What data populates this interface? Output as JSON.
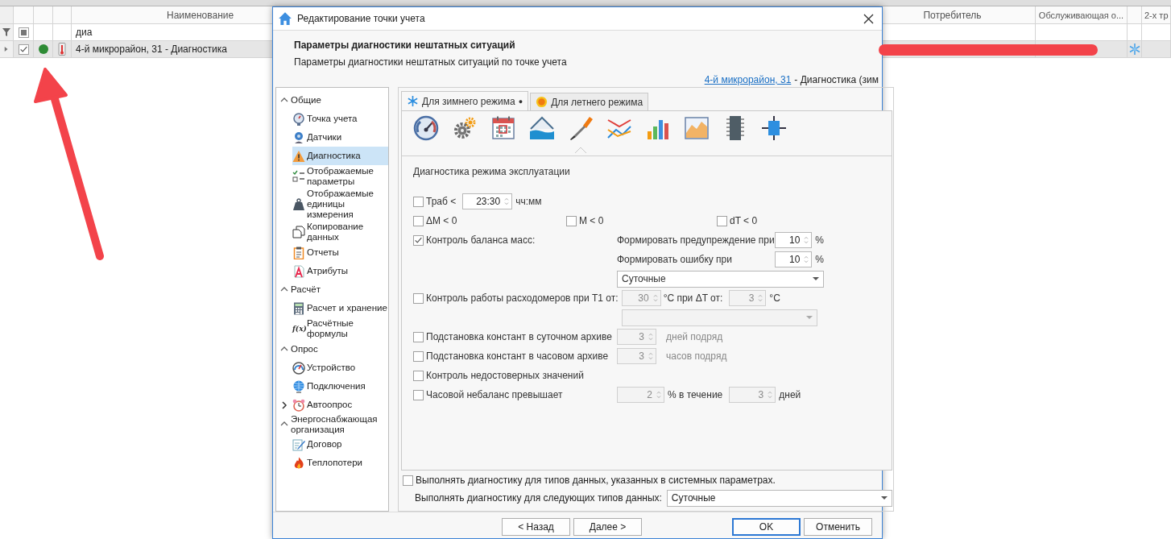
{
  "background_grid": {
    "columns": [
      {
        "label": "Наименование"
      },
      {
        "label": "Потребитель"
      },
      {
        "label": "Обслуживающая о..."
      },
      {
        "label": "2-х тр"
      }
    ],
    "filter": {
      "value": "диа",
      "indeterminate": true
    },
    "rows": [
      {
        "name": "4-й микрорайон, 31 - Диагностика",
        "checked": true,
        "selected": true
      }
    ]
  },
  "dialog": {
    "title": "Редактирование точки учета",
    "header": {
      "title": "Параметры диагностики нештатных ситуаций",
      "subtitle": "Параметры диагностики нештатных ситуаций по точке учета",
      "link": "4-й микрорайон, 31",
      "link_suffix": "- Диагностика (зим"
    },
    "nav": {
      "sections": [
        {
          "label": "Общие",
          "expanded": true,
          "items": [
            {
              "label": "Точка учета",
              "selected": false,
              "expandable": false
            },
            {
              "label": "Датчики",
              "selected": false,
              "expandable": false
            },
            {
              "label": "Диагностика",
              "selected": true,
              "expandable": false
            },
            {
              "label": "Отображаемые параметры",
              "selected": false,
              "expandable": false
            },
            {
              "label": "Отображаемые единицы измерения",
              "selected": false,
              "expandable": false
            },
            {
              "label": "Копирование данных",
              "selected": false,
              "expandable": false
            },
            {
              "label": "Отчеты",
              "selected": false,
              "expandable": false
            },
            {
              "label": "Атрибуты",
              "selected": false,
              "expandable": false
            }
          ]
        },
        {
          "label": "Расчёт",
          "expanded": true,
          "items": [
            {
              "label": "Расчет и хранение",
              "selected": false,
              "expandable": false
            },
            {
              "label": "Расчётные формулы",
              "selected": false,
              "expandable": false,
              "icon_text": "f(x)"
            }
          ]
        },
        {
          "label": "Опрос",
          "expanded": true,
          "items": [
            {
              "label": "Устройство",
              "selected": false,
              "expandable": false
            },
            {
              "label": "Подключения",
              "selected": false,
              "expandable": false
            },
            {
              "label": "Автоопрос",
              "selected": false,
              "expandable": true
            }
          ]
        },
        {
          "label": "Энергоснабжающая организация",
          "expanded": true,
          "items": [
            {
              "label": "Договор",
              "selected": false,
              "expandable": false
            },
            {
              "label": "Теплопотери",
              "selected": false,
              "expandable": false
            }
          ]
        }
      ]
    },
    "tabs": [
      {
        "label": "Для зимнего режима",
        "marker": "●",
        "selected": true
      },
      {
        "label": "Для летнего режима",
        "selected": false
      }
    ],
    "toolbar": [
      {
        "selected": false
      },
      {
        "selected": false
      },
      {
        "selected": false
      },
      {
        "selected": false
      },
      {
        "selected": true
      },
      {
        "selected": false
      },
      {
        "selected": false
      },
      {
        "selected": false
      },
      {
        "selected": false
      },
      {
        "selected": false
      }
    ],
    "section_title": "Диагностика режима эксплуатации",
    "rows": [
      {
        "kind": "time",
        "label": "Траб <",
        "checked": false,
        "spinner": {
          "value": "23:30",
          "disabled": false
        },
        "unit": "чч:мм"
      },
      {
        "kind": "triple",
        "items": [
          {
            "label": "ΔM < 0",
            "checked": false
          },
          {
            "label": "M < 0",
            "checked": false
          },
          {
            "label": "dT < 0",
            "checked": false
          }
        ]
      },
      {
        "kind": "balance",
        "label": "Контроль баланса масс:",
        "checked": true,
        "warning_label": "Формировать предупреждение при",
        "warning": {
          "value": "10",
          "disabled": false
        },
        "warning_unit": "%",
        "error_label": "Формировать ошибку при",
        "error": {
          "value": "10",
          "disabled": false
        },
        "error_unit": "%",
        "period": {
          "value": "Суточные",
          "disabled": false
        }
      },
      {
        "kind": "flowmeter",
        "label": "Контроль работы расходомеров при T1 от:",
        "checked": false,
        "t1": {
          "value": "30",
          "disabled": true
        },
        "t1_unit": "°C при ΔT от:",
        "dt": {
          "value": "3",
          "disabled": true
        },
        "dt_unit": "°C",
        "period": {
          "disabled": true
        }
      },
      {
        "kind": "count",
        "label": "Подстановка констант в суточном архиве",
        "checked": false,
        "spinner": {
          "value": "3",
          "disabled": true
        },
        "unit": "дней подряд"
      },
      {
        "kind": "count",
        "label": "Подстановка констант в часовом архиве",
        "checked": false,
        "spinner": {
          "value": "3",
          "disabled": true
        },
        "unit": "часов подряд"
      },
      {
        "kind": "plain",
        "label": "Контроль недостоверных значений",
        "checked": false
      },
      {
        "kind": "imbalance",
        "label": "Часовой небаланс превышает",
        "checked": false,
        "spinner": {
          "value": "2",
          "disabled": true
        },
        "middle": "% в течение",
        "spinner2": {
          "value": "3",
          "disabled": true
        },
        "unit": "дней"
      }
    ],
    "system_types": {
      "label": "Выполнять диагностику для типов данных, указанных в системных параметрах.",
      "checked": false
    },
    "data_types": {
      "label": "Выполнять диагностику для следующих типов данных:",
      "value": "Суточные"
    },
    "buttons": [
      {
        "label": "< Назад",
        "kind": "nav",
        "default": false
      },
      {
        "label": "Далее >",
        "kind": "nav",
        "default": false
      },
      {
        "label": "OK",
        "kind": "confirm",
        "default": true
      },
      {
        "label": "Отменить",
        "kind": "confirm",
        "default": false
      }
    ]
  }
}
